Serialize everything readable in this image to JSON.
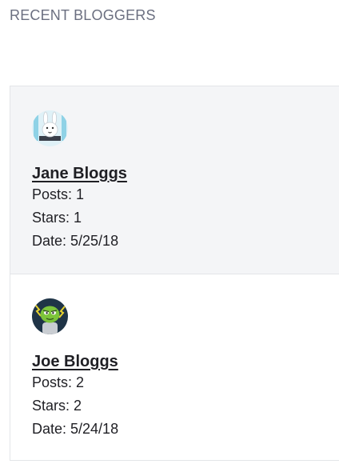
{
  "section": {
    "title": "RECENT BLOGGERS"
  },
  "bloggers": [
    {
      "name": "Jane Bloggs",
      "avatar_icon": "bunny-avatar-icon",
      "posts_label": "Posts: 1",
      "stars_label": "Stars: 1",
      "date_label": "Date: 5/25/18"
    },
    {
      "name": "Joe Bloggs",
      "avatar_icon": "green-monster-avatar-icon",
      "posts_label": "Posts: 2",
      "stars_label": "Stars: 2",
      "date_label": "Date: 5/24/18"
    }
  ]
}
